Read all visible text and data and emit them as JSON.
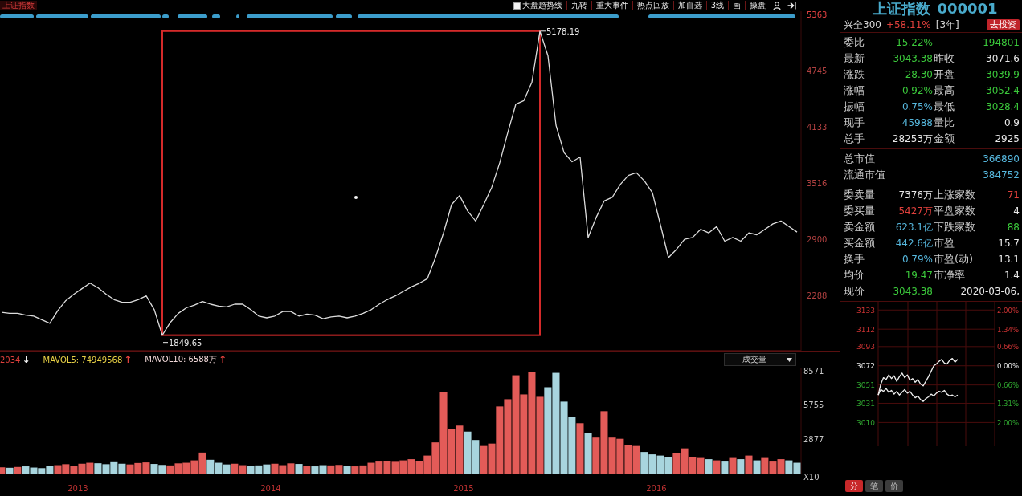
{
  "chart_title": "上证指数",
  "trend_toggle": {
    "label": "大盘趋势线",
    "checked": false
  },
  "toolbar": [
    {
      "label": "九转"
    },
    {
      "label": "重大事件"
    },
    {
      "label": "热点回放"
    },
    {
      "label": "加自选"
    },
    {
      "label": "3线"
    },
    {
      "label": "画"
    },
    {
      "label": "操盘"
    }
  ],
  "price_chart": {
    "chart_data": {
      "type": "line",
      "ylim": [
        1680,
        5398
      ],
      "yticks": [
        {
          "value": 5363,
          "label": "5363"
        },
        {
          "value": 4745,
          "label": "4745"
        },
        {
          "value": 4133,
          "label": "4133"
        },
        {
          "value": 3516,
          "label": "3516"
        },
        {
          "value": 2900,
          "label": "2900"
        },
        {
          "value": 2288,
          "label": "2288"
        }
      ],
      "categories": [
        null,
        null,
        null,
        null,
        null,
        null,
        null,
        null,
        null,
        null,
        null,
        null,
        null,
        null,
        null,
        null,
        null,
        null,
        null,
        null,
        null,
        null,
        null,
        null,
        null,
        null,
        null,
        null,
        null,
        null,
        null,
        null,
        null,
        null,
        null,
        null,
        null,
        null,
        null,
        null,
        null,
        null,
        null,
        null,
        null,
        null,
        null,
        null,
        null,
        null,
        null,
        null,
        null,
        null,
        null,
        null,
        null,
        null,
        null,
        null,
        null,
        null,
        null,
        null,
        null,
        null,
        null,
        null,
        null,
        null,
        null,
        null,
        null,
        null,
        null,
        null,
        null,
        null,
        null,
        null,
        null,
        null,
        null,
        null,
        null,
        null,
        null,
        null,
        null,
        null,
        null,
        null,
        null,
        null,
        null,
        null,
        null,
        null,
        null,
        null
      ],
      "series": [
        {
          "values": [
            2100,
            2090,
            2090,
            2070,
            2060,
            2020,
            1980,
            2120,
            2230,
            2300,
            2360,
            2420,
            2370,
            2300,
            2240,
            2210,
            2210,
            2240,
            2280,
            2130,
            1850,
            1990,
            2090,
            2150,
            2180,
            2220,
            2190,
            2170,
            2160,
            2190,
            2190,
            2130,
            2060,
            2040,
            2060,
            2110,
            2110,
            2060,
            2080,
            2070,
            2030,
            2050,
            2060,
            2040,
            2060,
            2090,
            2130,
            2190,
            2240,
            2280,
            2330,
            2380,
            2420,
            2470,
            2700,
            2970,
            3280,
            3380,
            3210,
            3100,
            3280,
            3470,
            3740,
            4070,
            4380,
            4420,
            4620,
            5180,
            4910,
            4150,
            3850,
            3750,
            3800,
            2920,
            3140,
            3320,
            3360,
            3500,
            3600,
            3630,
            3540,
            3410,
            3060,
            2700,
            2790,
            2900,
            2920,
            3010,
            2970,
            3040,
            2880,
            2920,
            2880,
            2970,
            2950,
            3010,
            3070,
            3100,
            3040,
            2980
          ]
        }
      ],
      "annotations": [
        "5178.19",
        "1849.65"
      ]
    }
  },
  "volume_panel": {
    "indicators": [
      {
        "text": "2034",
        "color": "#e0403c",
        "arrow": {
          "text": "↓",
          "color": "#f0f0f0"
        }
      },
      {
        "text": "MAVOL5: 74949568",
        "color": "#e6cf45",
        "arrow": {
          "text": "↑",
          "color": "#e0403c"
        }
      },
      {
        "text": "MAVOL10: 6588万",
        "color": "#f0d8d8",
        "arrow": {
          "text": "↑",
          "color": "#e0403c"
        }
      }
    ],
    "selector": {
      "label": "成交量"
    },
    "unit_label": "X10",
    "chart_data": {
      "type": "bar",
      "ylim": [
        0,
        8840
      ],
      "yticks": [
        {
          "value": 8571,
          "label": "8571"
        },
        {
          "value": 5755,
          "label": "5755"
        },
        {
          "value": 2877,
          "label": "2877"
        }
      ],
      "xlim": [
        2012.596,
        2016.95
      ],
      "x": [
        2012.604,
        2012.646,
        2012.687,
        2012.729,
        2012.771,
        2012.812,
        2012.854,
        2012.896,
        2012.937,
        2012.979,
        2013.021,
        2013.062,
        2013.104,
        2013.146,
        2013.187,
        2013.229,
        2013.271,
        2013.312,
        2013.354,
        2013.396,
        2013.437,
        2013.479,
        2013.521,
        2013.562,
        2013.604,
        2013.646,
        2013.687,
        2013.729,
        2013.771,
        2013.812,
        2013.854,
        2013.896,
        2013.937,
        2013.979,
        2014.021,
        2014.062,
        2014.104,
        2014.146,
        2014.187,
        2014.229,
        2014.271,
        2014.312,
        2014.354,
        2014.396,
        2014.437,
        2014.479,
        2014.521,
        2014.562,
        2014.604,
        2014.646,
        2014.687,
        2014.729,
        2014.771,
        2014.812,
        2014.854,
        2014.896,
        2014.937,
        2014.979,
        2015.021,
        2015.062,
        2015.104,
        2015.146,
        2015.187,
        2015.229,
        2015.271,
        2015.312,
        2015.354,
        2015.396,
        2015.437,
        2015.479,
        2015.521,
        2015.562,
        2015.604,
        2015.646,
        2015.687,
        2015.729,
        2015.771,
        2015.812,
        2015.854,
        2015.896,
        2015.937,
        2015.979,
        2016.021,
        2016.062,
        2016.104,
        2016.146,
        2016.187,
        2016.229,
        2016.271,
        2016.312,
        2016.354,
        2016.396,
        2016.437,
        2016.479,
        2016.521,
        2016.562,
        2016.604,
        2016.646,
        2016.687,
        2016.729
      ],
      "xticks": [
        2013,
        2014,
        2015,
        2016
      ],
      "series": [
        {
          "values": [
            520,
            480,
            550,
            600,
            500,
            450,
            620,
            700,
            780,
            650,
            820,
            900,
            860,
            780,
            950,
            820,
            760,
            880,
            930,
            800,
            720,
            680,
            850,
            900,
            1100,
            1750,
            1150,
            900,
            760,
            820,
            700,
            620,
            680,
            760,
            820,
            700,
            850,
            800,
            650,
            600,
            700,
            680,
            720,
            640,
            600,
            680,
            900,
            1000,
            1050,
            980,
            1100,
            1200,
            1050,
            1500,
            2600,
            6800,
            3700,
            4000,
            3500,
            2800,
            2300,
            2500,
            5600,
            6200,
            8200,
            6600,
            8500,
            6400,
            7200,
            8400,
            6000,
            4700,
            4200,
            3400,
            3000,
            5200,
            3000,
            2900,
            2400,
            2300,
            1800,
            1600,
            1500,
            1400,
            1700,
            2100,
            1400,
            1300,
            1200,
            1100,
            1000,
            1300,
            1200,
            1500,
            1100,
            1300,
            1000,
            1200,
            1100,
            900
          ]
        }
      ]
    }
  },
  "quote": {
    "title": "上证指数",
    "code": "000001",
    "fund": {
      "name": "兴全300",
      "return": "+58.11%",
      "period": "[3年]",
      "button": "去投资"
    },
    "sections": [
      {
        "rows": [
          {
            "label": "委比",
            "value": {
              "text": "-15.22%",
              "color": "#3bc83b"
            },
            "value_2": {
              "text": "-194801",
              "color": "#3bc83b"
            }
          },
          {
            "label": "最新",
            "value": {
              "text": "3043.38",
              "color": "#3bc83b"
            },
            "label_2": "昨收",
            "value_2": {
              "text": "3071.6",
              "color": "#e8e8e8"
            }
          },
          {
            "label": "涨跌",
            "value": {
              "text": "-28.30",
              "color": "#3bc83b"
            },
            "label_2": "开盘",
            "value_2": {
              "text": "3039.9",
              "color": "#3bc83b"
            }
          },
          {
            "label": "涨幅",
            "value": {
              "text": "-0.92%",
              "color": "#3bc83b"
            },
            "label_2": "最高",
            "value_2": {
              "text": "3052.4",
              "color": "#3bc83b"
            }
          },
          {
            "label": "振幅",
            "value": {
              "text": "0.75%",
              "color": "#56b7dd"
            },
            "label_2": "最低",
            "value_2": {
              "text": "3028.4",
              "color": "#3bc83b"
            }
          },
          {
            "label": "现手",
            "value": {
              "text": "45988",
              "color": "#56b7dd"
            },
            "label_2": "量比",
            "value_2": {
              "text": "0.9",
              "color": "#e8e8e8"
            }
          },
          {
            "label": "总手",
            "value": {
              "text": "28253万",
              "color": "#e8e8e8"
            },
            "label_2": "金额",
            "value_2": {
              "text": "2925",
              "color": "#e8e8e8"
            }
          }
        ]
      },
      {
        "rows": [
          {
            "label": "总市值",
            "value_2": {
              "text": "366890",
              "color": "#56b7dd"
            }
          },
          {
            "label": "流通市值",
            "value_2": {
              "text": "384752",
              "color": "#56b7dd"
            }
          }
        ]
      },
      {
        "rows": [
          {
            "label": "委卖量",
            "value": {
              "text": "7376万",
              "color": "#e8e8e8"
            },
            "label_2": "上涨家数",
            "value_2": {
              "text": "71",
              "color": "#e0403c"
            }
          },
          {
            "label": "委买量",
            "value": {
              "text": "5427万",
              "color": "#e0403c"
            },
            "label_2": "平盘家数",
            "value_2": {
              "text": "4",
              "color": "#e8e8e8"
            }
          },
          {
            "label": "卖金额",
            "value": {
              "text": "623.1亿",
              "color": "#56b7dd"
            },
            "label_2": "下跌家数",
            "value_2": {
              "text": "88",
              "color": "#3bc83b"
            }
          },
          {
            "label": "买金额",
            "value": {
              "text": "442.6亿",
              "color": "#56b7dd"
            },
            "label_2": "市盈",
            "value_2": {
              "text": "15.7",
              "color": "#e8e8e8"
            }
          },
          {
            "label": "换手",
            "value": {
              "text": "0.79%",
              "color": "#56b7dd"
            },
            "label_2": "市盈(动)",
            "value_2": {
              "text": "13.1",
              "color": "#e8e8e8"
            }
          },
          {
            "label": "均价",
            "value": {
              "text": "19.47",
              "color": "#3bc83b"
            },
            "label_2": "市净率",
            "value_2": {
              "text": "1.4",
              "color": "#e8e8e8"
            }
          },
          {
            "label": "现价",
            "value": {
              "text": "3043.38",
              "color": "#3bc83b"
            },
            "value_2": {
              "text": "2020-03-06,",
              "color": "#e8e8e8"
            }
          }
        ]
      }
    ]
  },
  "intraday_chart": {
    "chart_data": {
      "type": "line",
      "grid": true,
      "ylim": [
        2984,
        3142
      ],
      "yticks": [
        {
          "value": 3133,
          "label": "3133"
        },
        {
          "value": 3112,
          "label": "3112"
        },
        {
          "value": 3093,
          "label": "3093"
        },
        {
          "value": 3072,
          "label": "3072"
        },
        {
          "value": 3051,
          "label": "3051"
        },
        {
          "value": 3031,
          "label": "3031"
        },
        {
          "value": 3010,
          "label": "3010"
        }
      ],
      "categories": [
        null,
        null,
        null,
        null,
        null,
        null,
        null,
        null,
        null,
        null,
        null,
        null,
        null,
        null,
        null,
        null,
        null,
        null,
        null,
        null,
        null,
        null,
        null,
        null,
        null,
        null,
        null,
        null,
        null,
        null,
        null,
        null,
        null,
        null,
        null,
        null,
        null,
        null,
        null,
        null,
        null,
        null,
        null,
        null
      ],
      "series": [
        {
          "values": [
            3040,
            3052,
            3059,
            3057,
            3062,
            3058,
            3061,
            3055,
            3060,
            3064,
            3059,
            3062,
            3056,
            3058,
            3054,
            3057,
            3052,
            3050,
            3055,
            3060,
            3066,
            3072,
            3074,
            3077,
            3079,
            3075,
            3074,
            3078,
            3080,
            3076,
            3079,
            null,
            null,
            null,
            null,
            null,
            null,
            null,
            null,
            null,
            null,
            null,
            null,
            null
          ]
        },
        {
          "values": [
            3040,
            3046,
            3044,
            3047,
            3043,
            3045,
            3041,
            3044,
            3040,
            3043,
            3046,
            3042,
            3044,
            3040,
            3037,
            3039,
            3035,
            3033,
            3036,
            3038,
            3041,
            3039,
            3042,
            3044,
            3043,
            3045,
            3041,
            3039,
            3040,
            3038,
            3040,
            null,
            null,
            null,
            null,
            null,
            null,
            null,
            null,
            null,
            null,
            null,
            null,
            null
          ]
        }
      ]
    },
    "right_labels": [
      "2.00%",
      "1.34%",
      "0.66%",
      "0.00%",
      "0.66%",
      "1.31%",
      "2.00%"
    ]
  },
  "period_tabs": [
    {
      "label": "分",
      "selected": true
    },
    {
      "label": "笔",
      "selected": false
    },
    {
      "label": "价",
      "selected": false
    }
  ]
}
